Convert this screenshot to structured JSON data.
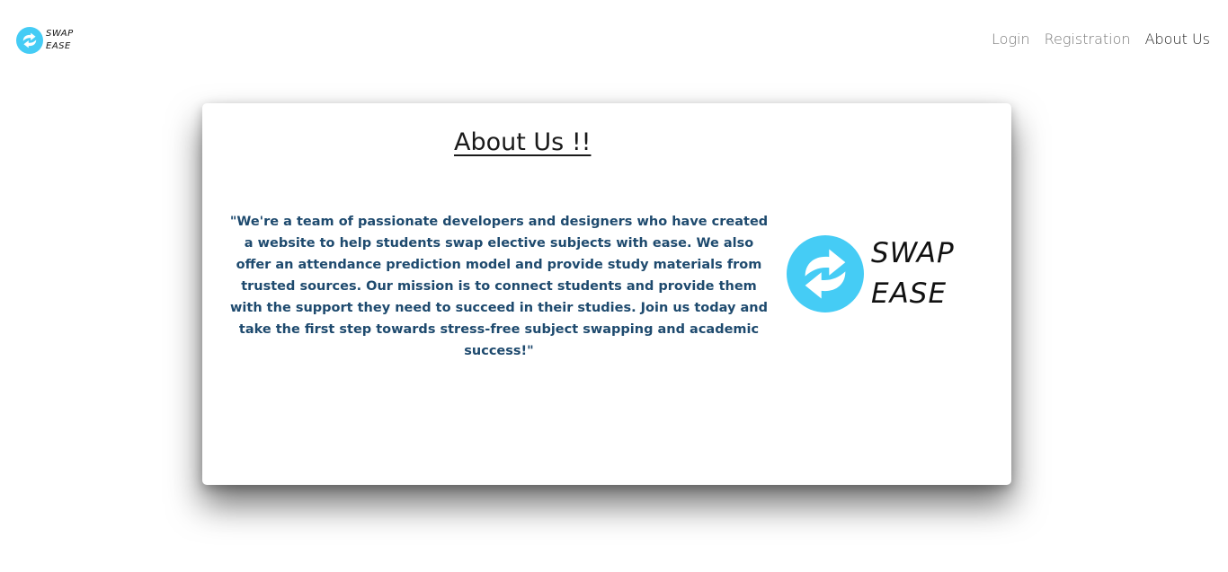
{
  "header": {
    "logo": {
      "line1": "SWAP",
      "line2": "EASE",
      "icon": "swap-arrows-icon",
      "color": "#45ccf5"
    },
    "nav": [
      {
        "label": "Login",
        "active": false
      },
      {
        "label": "Registration",
        "active": false
      },
      {
        "label": "About Us",
        "active": true
      }
    ]
  },
  "main": {
    "title": "About Us !!",
    "body": "\"We're a team of passionate developers and designers who have created a website to help students swap elective subjects with ease. We also offer an attendance prediction model and provide study materials from trusted sources. Our mission is to connect students and provide them with the support they need to succeed in their studies. Join us today and take the first step towards stress-free subject swapping and academic success!\"",
    "logo": {
      "line1": "SWAP",
      "line2": "EASE",
      "icon": "swap-arrows-icon"
    }
  },
  "colors": {
    "accent": "#45ccf5",
    "body_text": "#1e4a6e",
    "nav_text": "#777777",
    "nav_active": "#222222"
  }
}
